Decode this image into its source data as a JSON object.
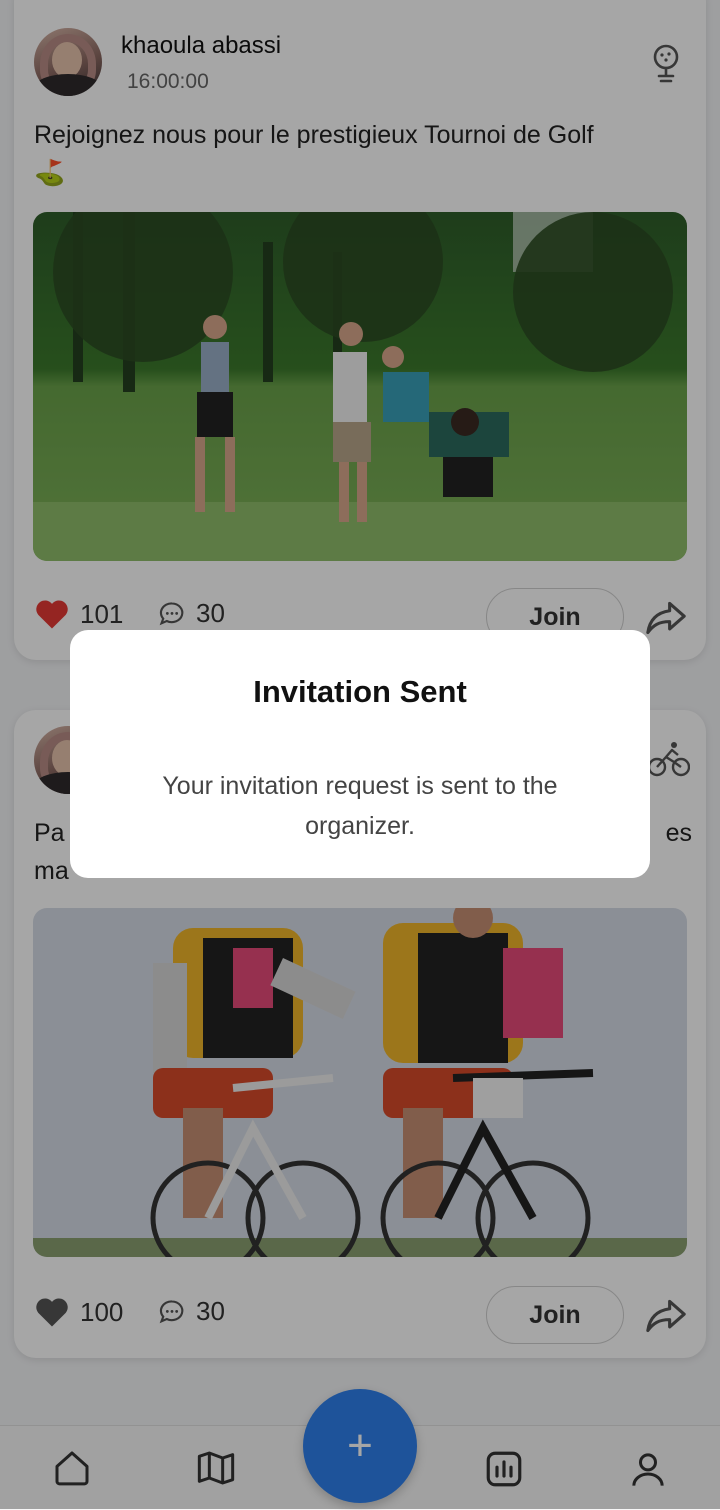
{
  "posts": [
    {
      "username": "khaoula abassi",
      "time": "16:00:00",
      "category_icon": "golf-icon",
      "description": "Rejoignez nous pour le prestigieux Tournoi de Golf",
      "emoji": "⛳",
      "likes": "101",
      "liked": true,
      "comments": "30",
      "join_label": "Join"
    },
    {
      "username": "",
      "category_icon": "cycling-icon",
      "description_left": "Pa",
      "description_right": "es",
      "description_line2": "ma",
      "likes": "100",
      "liked": false,
      "comments": "30",
      "join_label": "Join"
    }
  ],
  "dialog": {
    "title": "Invitation Sent",
    "message": "Your invitation request is sent to the organizer."
  },
  "nav": {
    "items": [
      "home-icon",
      "map-icon",
      "add-icon",
      "stats-icon",
      "profile-icon"
    ],
    "fab_label": "+"
  },
  "colors": {
    "accent": "#2f80ed",
    "like_active": "#e53935",
    "like_inactive": "#555555"
  }
}
